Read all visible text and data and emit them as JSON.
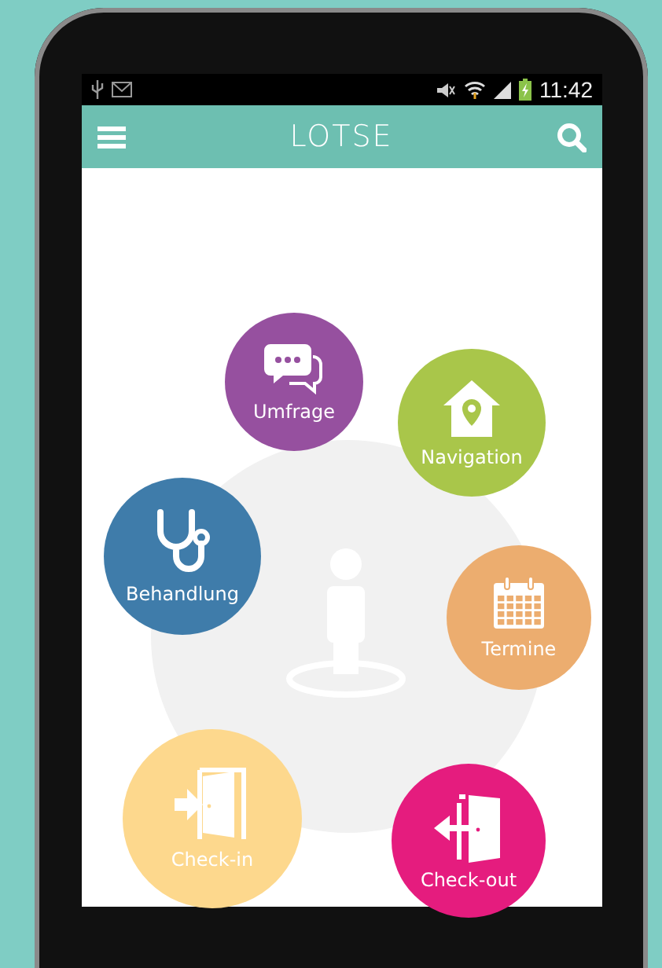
{
  "status_bar": {
    "time": "11:42"
  },
  "app_bar": {
    "title": "LOTSE"
  },
  "menu": [
    {
      "label": "Umfrage",
      "kind": "chat",
      "color": "#96509f"
    },
    {
      "label": "Navigation",
      "kind": "house-pin",
      "color": "#a9c64a"
    },
    {
      "label": "Behandlung",
      "kind": "stethoscope",
      "color": "#3f7caa"
    },
    {
      "label": "Termine",
      "kind": "calendar",
      "color": "#ecad6f"
    },
    {
      "label": "Check-in",
      "kind": "door-in",
      "color": "#fdd88d"
    },
    {
      "label": "Check-out",
      "kind": "door-out",
      "color": "#e51c7e"
    }
  ]
}
